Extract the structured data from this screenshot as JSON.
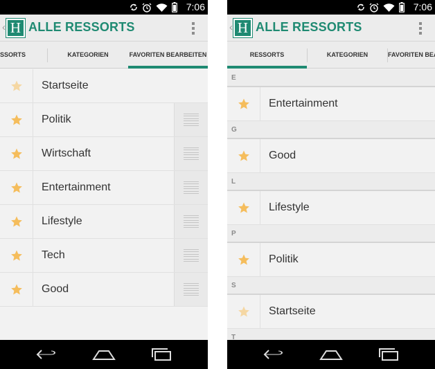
{
  "status_bar": {
    "time": "7:06",
    "icons": [
      "sync-icon",
      "alarm-icon",
      "wifi-icon",
      "battery-icon"
    ]
  },
  "app": {
    "logo_letter": "H",
    "title": "ALLE RESSORTS",
    "accent_color": "#1f8a72",
    "star_color": "#f5bd5c"
  },
  "left": {
    "tabs": [
      {
        "label": "SSORTS"
      },
      {
        "label": "KATEGORIEN"
      },
      {
        "label": "FAVORITEN BEARBEITEN",
        "active": true
      }
    ],
    "favorites": [
      {
        "label": "Startseite",
        "draggable": false
      },
      {
        "label": "Politik",
        "draggable": true
      },
      {
        "label": "Wirtschaft",
        "draggable": true
      },
      {
        "label": "Entertainment",
        "draggable": true
      },
      {
        "label": "Lifestyle",
        "draggable": true
      },
      {
        "label": "Tech",
        "draggable": true
      },
      {
        "label": "Good",
        "draggable": true
      }
    ]
  },
  "right": {
    "tabs": [
      {
        "label": "RESSORTS",
        "active": true
      },
      {
        "label": "KATEGORIEN"
      },
      {
        "label": "FAVORITEN BEAR"
      }
    ],
    "sections": [
      {
        "header": "E",
        "item": "Entertainment"
      },
      {
        "header": "G",
        "item": "Good"
      },
      {
        "header": "L",
        "item": "Lifestyle"
      },
      {
        "header": "P",
        "item": "Politik"
      },
      {
        "header": "S",
        "item": "Startseite"
      },
      {
        "header": "T",
        "item": ""
      }
    ]
  },
  "nav_bar": {
    "buttons": [
      "back-icon",
      "home-icon",
      "recents-icon"
    ]
  }
}
